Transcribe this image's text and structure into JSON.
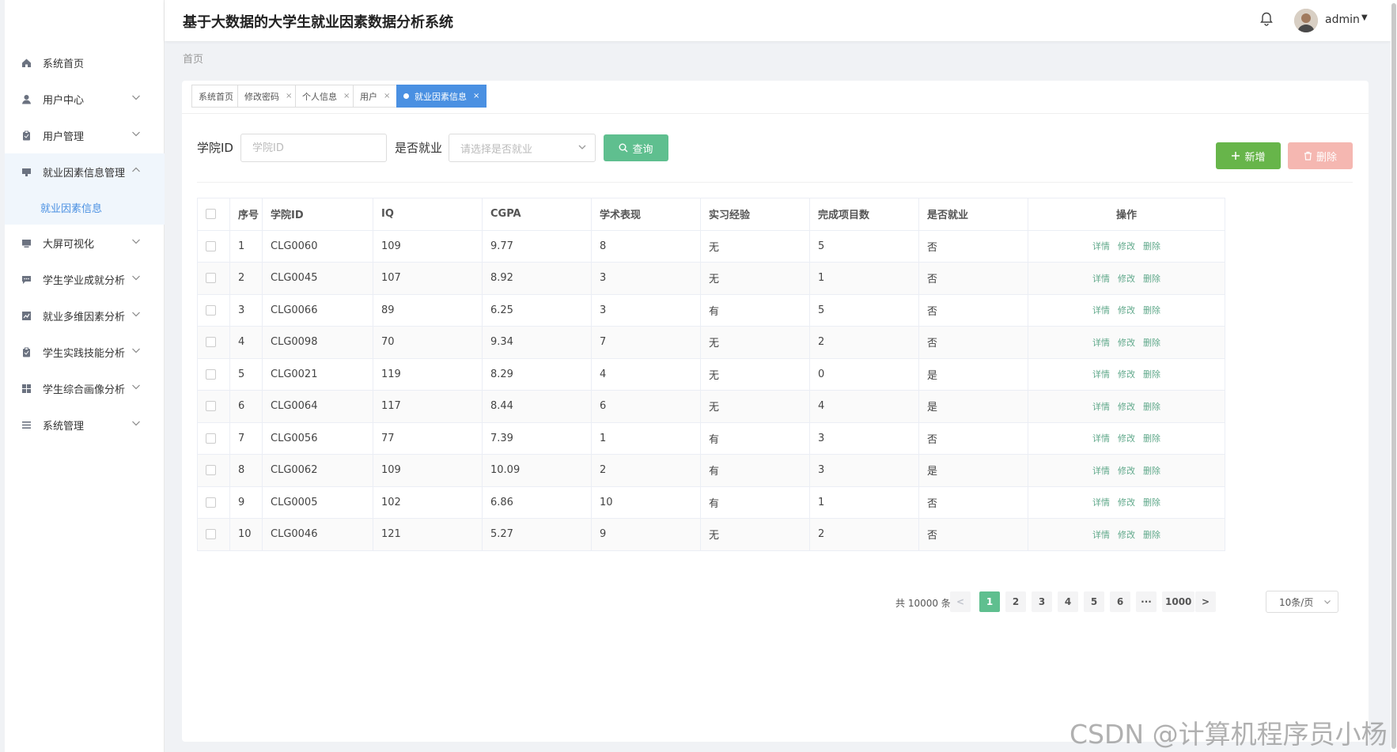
{
  "header": {
    "title": "基于大数据的大学生就业因素数据分析系统",
    "user_name": "admin"
  },
  "breadcrumb": "首页",
  "sidebar": {
    "items": [
      {
        "label": "系统首页",
        "icon": "home-icon",
        "has_chevron": false
      },
      {
        "label": "用户中心",
        "icon": "user-icon",
        "has_chevron": true
      },
      {
        "label": "用户管理",
        "icon": "clipboard-icon",
        "has_chevron": true
      },
      {
        "label": "就业因素信息管理",
        "icon": "monitor-icon",
        "has_chevron": true,
        "expanded": true
      },
      {
        "label": "大屏可视化",
        "icon": "screen-icon",
        "has_chevron": true
      },
      {
        "label": "学生学业成就分析",
        "icon": "chat-icon",
        "has_chevron": true
      },
      {
        "label": "就业多维因素分析",
        "icon": "chart-icon",
        "has_chevron": true
      },
      {
        "label": "学生实践技能分析",
        "icon": "clipboard-icon",
        "has_chevron": true
      },
      {
        "label": "学生综合画像分析",
        "icon": "grid-icon",
        "has_chevron": true
      },
      {
        "label": "系统管理",
        "icon": "list-icon",
        "has_chevron": true
      }
    ],
    "submenu_label": "就业因素信息"
  },
  "tabs": [
    {
      "label": "系统首页",
      "closable": false
    },
    {
      "label": "修改密码",
      "closable": true
    },
    {
      "label": "个人信息",
      "closable": true
    },
    {
      "label": "用户",
      "closable": true
    },
    {
      "label": "就业因素信息",
      "closable": true,
      "active": true
    }
  ],
  "search": {
    "id_label": "学院ID",
    "id_placeholder": "学院ID",
    "employed_label": "是否就业",
    "employed_placeholder": "请选择是否就业",
    "query_label": "查询"
  },
  "actions": {
    "add_label": "新增",
    "delete_label": "删除"
  },
  "table": {
    "columns": [
      "序号",
      "学院ID",
      "IQ",
      "CGPA",
      "学术表现",
      "实习经验",
      "完成项目数",
      "是否就业",
      "操作"
    ],
    "rows": [
      [
        "1",
        "CLG0060",
        "109",
        "9.77",
        "8",
        "无",
        "5",
        "否"
      ],
      [
        "2",
        "CLG0045",
        "107",
        "8.92",
        "3",
        "无",
        "1",
        "否"
      ],
      [
        "3",
        "CLG0066",
        "89",
        "6.25",
        "3",
        "有",
        "5",
        "否"
      ],
      [
        "4",
        "CLG0098",
        "70",
        "9.34",
        "7",
        "无",
        "2",
        "否"
      ],
      [
        "5",
        "CLG0021",
        "119",
        "8.29",
        "4",
        "无",
        "0",
        "是"
      ],
      [
        "6",
        "CLG0064",
        "117",
        "8.44",
        "6",
        "无",
        "4",
        "是"
      ],
      [
        "7",
        "CLG0056",
        "77",
        "7.39",
        "1",
        "有",
        "3",
        "否"
      ],
      [
        "8",
        "CLG0062",
        "109",
        "10.09",
        "2",
        "有",
        "3",
        "是"
      ],
      [
        "9",
        "CLG0005",
        "102",
        "6.86",
        "10",
        "有",
        "1",
        "否"
      ],
      [
        "10",
        "CLG0046",
        "121",
        "5.27",
        "9",
        "无",
        "2",
        "否"
      ]
    ],
    "row_actions": [
      "详情",
      "修改",
      "删除"
    ]
  },
  "pagination": {
    "total": "共 10000 条",
    "prev": "<",
    "next": ">",
    "pages": [
      "1",
      "2",
      "3",
      "4",
      "5",
      "6",
      "···",
      "1000"
    ],
    "current": "1",
    "page_size": "10条/页"
  },
  "watermark": "CSDN @计算机程序员小杨",
  "colors": {
    "primary": "#4a90e2",
    "success": "#5fbf8f",
    "add": "#67b54a",
    "danger_light": "#f5b7b1"
  }
}
